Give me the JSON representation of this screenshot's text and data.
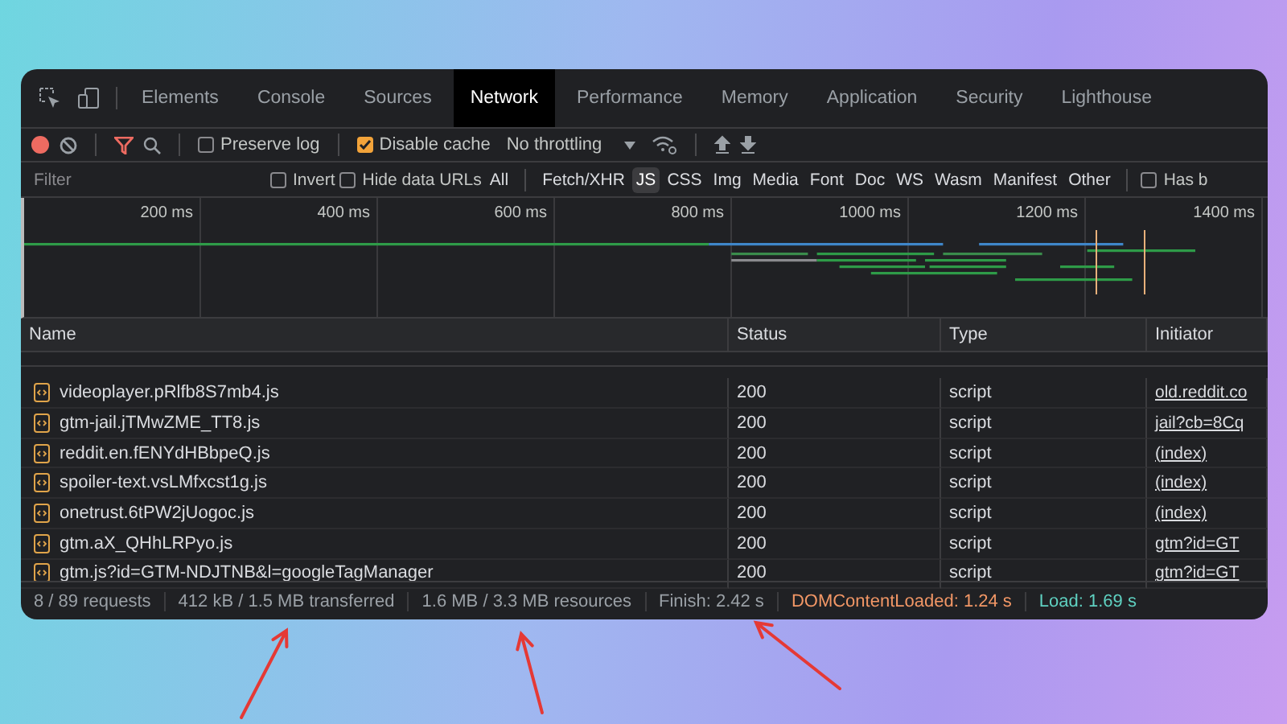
{
  "tabs": [
    {
      "label": "Elements",
      "selected": false
    },
    {
      "label": "Console",
      "selected": false
    },
    {
      "label": "Sources",
      "selected": false
    },
    {
      "label": "Network",
      "selected": true
    },
    {
      "label": "Performance",
      "selected": false
    },
    {
      "label": "Memory",
      "selected": false
    },
    {
      "label": "Application",
      "selected": false
    },
    {
      "label": "Security",
      "selected": false
    },
    {
      "label": "Lighthouse",
      "selected": false
    }
  ],
  "toolbar": {
    "preserve_log": {
      "label": "Preserve log",
      "checked": false
    },
    "disable_cache": {
      "label": "Disable cache",
      "checked": true
    },
    "throttling": "No throttling"
  },
  "filter_bar": {
    "placeholder": "Filter",
    "invert": {
      "label": "Invert",
      "checked": false
    },
    "hide_data_urls": {
      "label": "Hide data URLs",
      "checked": false
    },
    "types": [
      {
        "label": "All",
        "selected": false
      },
      {
        "label": "Fetch/XHR",
        "selected": false
      },
      {
        "label": "JS",
        "selected": true
      },
      {
        "label": "CSS",
        "selected": false
      },
      {
        "label": "Img",
        "selected": false
      },
      {
        "label": "Media",
        "selected": false
      },
      {
        "label": "Font",
        "selected": false
      },
      {
        "label": "Doc",
        "selected": false
      },
      {
        "label": "WS",
        "selected": false
      },
      {
        "label": "Wasm",
        "selected": false
      },
      {
        "label": "Manifest",
        "selected": false
      },
      {
        "label": "Other",
        "selected": false
      }
    ],
    "has_blocked": {
      "label": "Has b",
      "checked": false
    }
  },
  "timeline": {
    "ticks": [
      "200 ms",
      "400 ms",
      "600 ms",
      "800 ms",
      "1000 ms",
      "1200 ms",
      "1400 ms"
    ]
  },
  "table": {
    "columns": [
      "Name",
      "Status",
      "Type",
      "Initiator"
    ],
    "rows": [
      {
        "name": "videoplayer.pRlfb8S7mb4.js",
        "status": "200",
        "type": "script",
        "initiator": "old.reddit.co"
      },
      {
        "name": "gtm-jail.jTMwZME_TT8.js",
        "status": "200",
        "type": "script",
        "initiator": "jail?cb=8Cq"
      },
      {
        "name": "reddit.en.fENYdHBbpeQ.js",
        "status": "200",
        "type": "script",
        "initiator": "(index)"
      },
      {
        "name": "spoiler-text.vsLMfxcst1g.js",
        "status": "200",
        "type": "script",
        "initiator": "(index)"
      },
      {
        "name": "onetrust.6tPW2jUogoc.js",
        "status": "200",
        "type": "script",
        "initiator": "(index)"
      },
      {
        "name": "gtm.aX_QHhLRPyo.js",
        "status": "200",
        "type": "script",
        "initiator": "gtm?id=GT"
      },
      {
        "name": "gtm.js?id=GTM-NDJTNB&l=googleTagManager",
        "status": "200",
        "type": "script",
        "initiator": "gtm?id=GT"
      }
    ]
  },
  "status_bar": [
    {
      "text": "8 / 89 requests",
      "kind": "plain"
    },
    {
      "text": "412 kB / 1.5 MB transferred",
      "kind": "plain"
    },
    {
      "text": "1.6 MB / 3.3 MB resources",
      "kind": "plain"
    },
    {
      "text": "Finish: 2.42 s",
      "kind": "plain"
    },
    {
      "text": "DOMContentLoaded: 1.24 s",
      "kind": "dom"
    },
    {
      "text": "Load: 1.69 s",
      "kind": "load"
    }
  ]
}
